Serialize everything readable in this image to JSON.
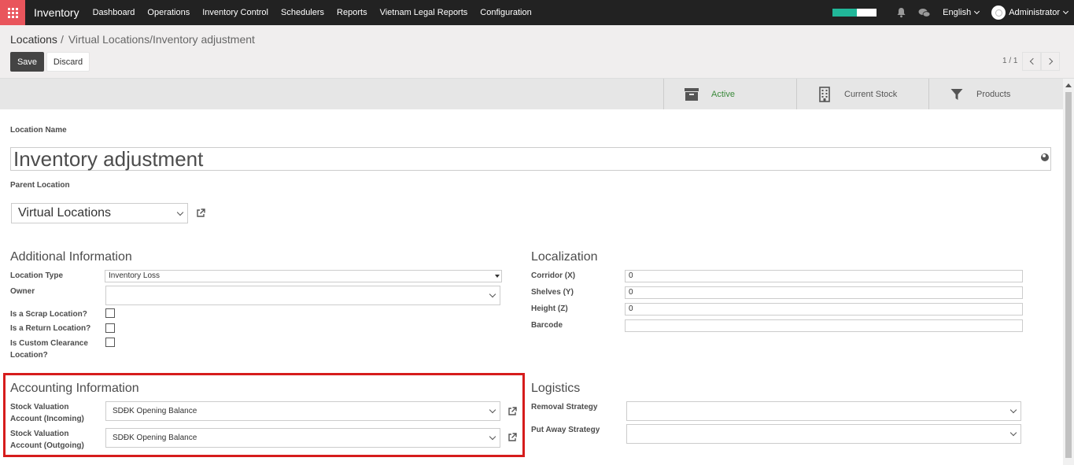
{
  "topbar": {
    "app_title": "Inventory",
    "menu": [
      "Dashboard",
      "Operations",
      "Inventory Control",
      "Schedulers",
      "Reports",
      "Vietnam Legal Reports",
      "Configuration"
    ],
    "language": "English",
    "user": "Administrator",
    "progress_fraction": 0.55,
    "accent_color": "#21b799"
  },
  "control": {
    "breadcrumb_parent": "Locations",
    "breadcrumb_sep": "/",
    "breadcrumb_current": "Virtual Locations/Inventory adjustment",
    "save_label": "Save",
    "discard_label": "Discard",
    "pager": "1 / 1"
  },
  "button_box": {
    "active_label": "Active",
    "current_stock_label": "Current Stock",
    "products_label": "Products"
  },
  "form": {
    "location_name_label": "Location Name",
    "location_name": "Inventory adjustment",
    "parent_location_label": "Parent Location",
    "parent_location": "Virtual Locations",
    "additional_info": {
      "title": "Additional Information",
      "location_type_label": "Location Type",
      "location_type": "Inventory Loss",
      "owner_label": "Owner",
      "owner": "",
      "scrap_label": "Is a Scrap Location?",
      "scrap": false,
      "return_label": "Is a Return Location?",
      "return": false,
      "custom_clearance_label": "Is Custom Clearance Location?",
      "custom_clearance": false
    },
    "localization": {
      "title": "Localization",
      "corridor_label": "Corridor (X)",
      "corridor": "0",
      "shelves_label": "Shelves (Y)",
      "shelves": "0",
      "height_label": "Height (Z)",
      "height": "0",
      "barcode_label": "Barcode",
      "barcode": ""
    },
    "accounting": {
      "title": "Accounting Information",
      "incoming_label": "Stock Valuation Account (Incoming)",
      "incoming": "SDĐK Opening Balance",
      "outgoing_label": "Stock Valuation Account (Outgoing)",
      "outgoing": "SDĐK Opening Balance",
      "highlight_color": "#d61c1c"
    },
    "logistics": {
      "title": "Logistics",
      "removal_label": "Removal Strategy",
      "removal": "",
      "putaway_label": "Put Away Strategy",
      "putaway": ""
    }
  }
}
